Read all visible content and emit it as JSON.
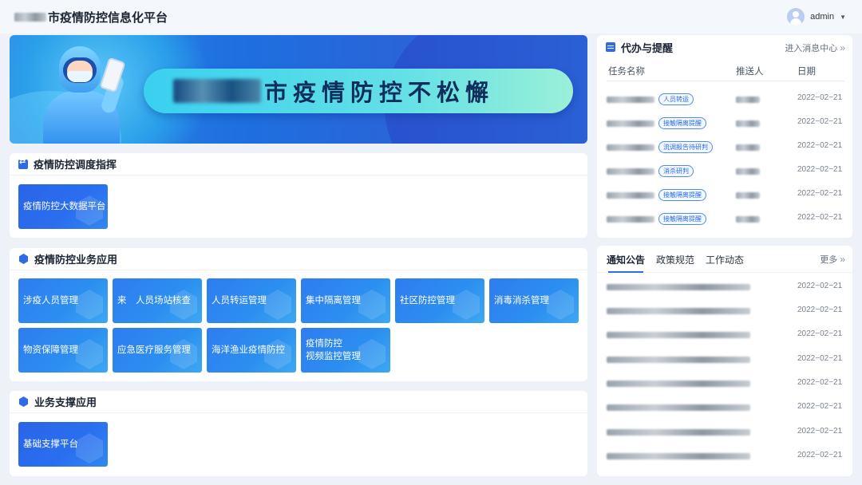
{
  "header": {
    "title": "市疫情防控信息化平台",
    "user": "admin",
    "caret": "▼"
  },
  "banner": {
    "slogan": "市疫情防控不松懈"
  },
  "dispatch": {
    "title": "疫情防控调度指挥",
    "tiles": [
      "疫情防控大数据平台"
    ]
  },
  "business": {
    "title": "疫情防控业务应用",
    "tiles": [
      "涉疫人员管理",
      "来　人员场站核查",
      "人员转运管理",
      "集中隔离管理",
      "社区防控管理",
      "消毒消杀管理",
      "物资保障管理",
      "应急医疗服务管理",
      "海洋渔业疫情防控",
      "疫情防控\n视频监控管理"
    ]
  },
  "support": {
    "title": "业务支撑应用",
    "tiles": [
      "基础支撑平台"
    ]
  },
  "todo": {
    "title": "代办与提醒",
    "more": "进入消息中心",
    "more_icon": "»",
    "columns": [
      "任务名称",
      "推送人",
      "日期"
    ],
    "rows": [
      {
        "tag": "人员转运",
        "date": "2022−02−21"
      },
      {
        "tag": "接触隔离提醒",
        "date": "2022−02−21"
      },
      {
        "tag": "流调报告待研判",
        "date": "2022−02−21"
      },
      {
        "tag": "消杀研判",
        "date": "2022−02−21"
      },
      {
        "tag": "接触隔离提醒",
        "date": "2022−02−21"
      },
      {
        "tag": "接触隔离提醒",
        "date": "2022−02−21"
      }
    ]
  },
  "notices": {
    "tabs": [
      "通知公告",
      "政策规范",
      "工作动态"
    ],
    "more": "更多",
    "more_icon": "»",
    "rows": [
      {
        "date": "2022−02−21"
      },
      {
        "date": "2022−02−21"
      },
      {
        "date": "2022−02−21"
      },
      {
        "date": "2022−02−21"
      },
      {
        "date": "2022−02−21"
      },
      {
        "date": "2022−02−21"
      },
      {
        "date": "2022−02−21"
      },
      {
        "date": "2022−02−21"
      }
    ]
  },
  "colors": {
    "accent": "#2e6be6",
    "tile": "#2f7cf0",
    "background": "#eef2f8"
  }
}
